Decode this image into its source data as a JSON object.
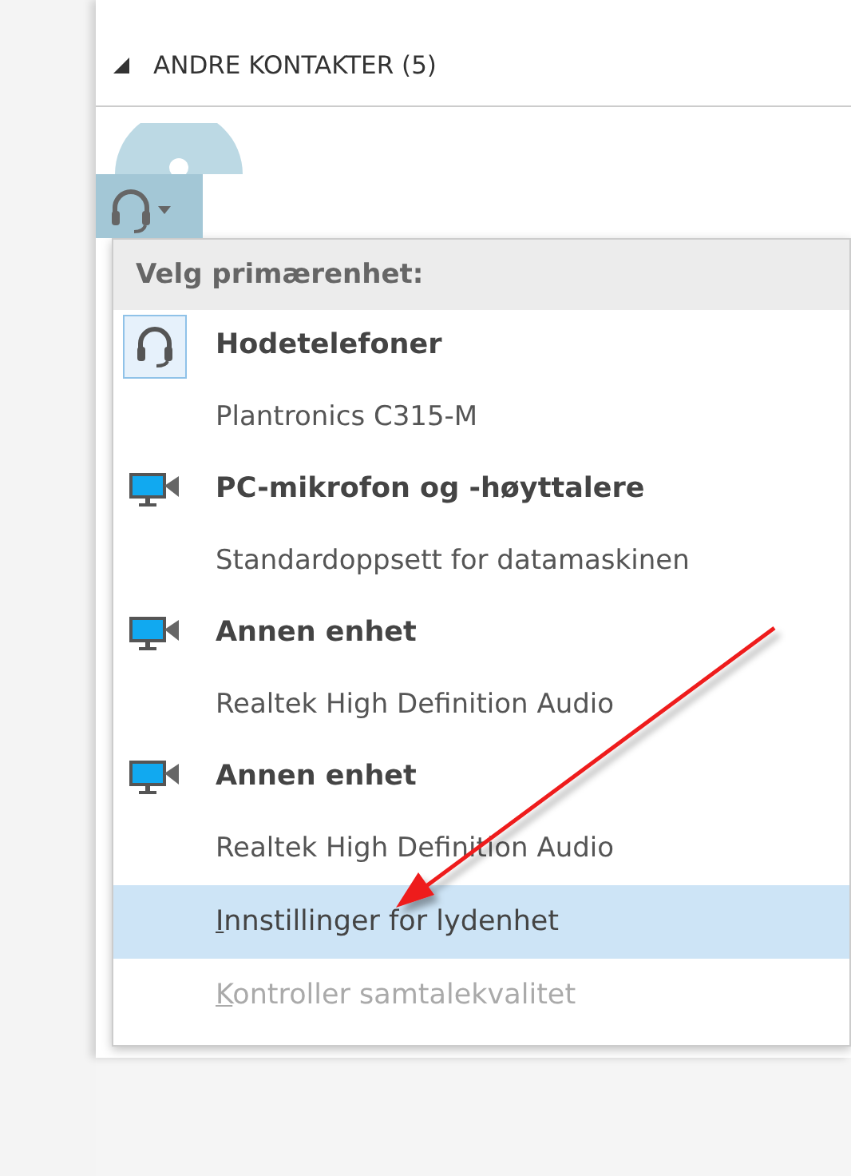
{
  "group": {
    "label": "ANDRE KONTAKTER (5)",
    "expanded": true
  },
  "device_menu": {
    "header": "Velg primærenhet:",
    "devices": [
      {
        "kind": "headset",
        "name": "Hodetelefoner",
        "description": "Plantronics C315-M",
        "selected": true
      },
      {
        "kind": "computer",
        "name": "PC-mikrofon og -høyttalere",
        "description": "Standardoppsett for datamaskinen",
        "selected": false
      },
      {
        "kind": "computer",
        "name": "Annen enhet",
        "description": "Realtek High Definition Audio",
        "selected": false
      },
      {
        "kind": "computer",
        "name": "Annen enhet",
        "description": "Realtek High Definition Audio",
        "selected": false
      }
    ],
    "actions": [
      {
        "label": "Innstillinger for lydenhet",
        "selected": true,
        "disabled": false
      },
      {
        "label": "Kontroller samtalekvalitet",
        "selected": false,
        "disabled": true
      }
    ]
  }
}
